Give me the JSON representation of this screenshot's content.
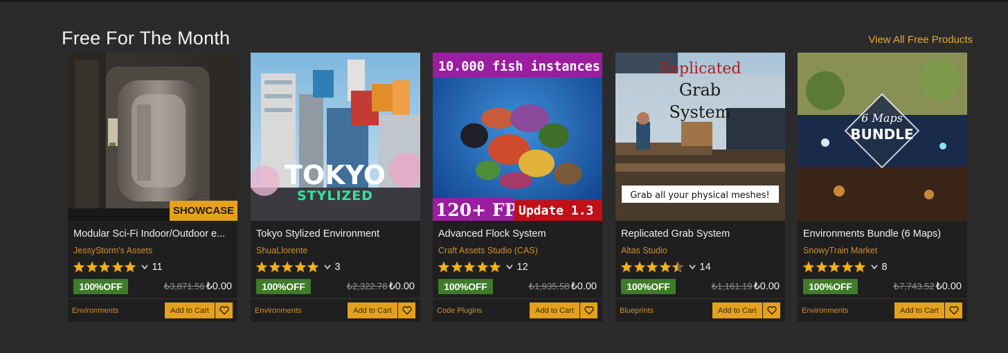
{
  "section": {
    "title": "Free For The Month",
    "view_all": "View All Free Products"
  },
  "colors": {
    "background": "#2b2b2b",
    "card": "#1f1f1f",
    "accent": "#e4a11b",
    "seller": "#cf8f2e",
    "discount_badge": "#3f7b2a"
  },
  "cards": [
    {
      "title": "Modular Sci-Fi Indoor/Outdoor e...",
      "seller": "JessyStorm's Assets",
      "rating": 5,
      "rating_count": "11",
      "discount": "100%OFF",
      "old_price": "₺3,871.56",
      "new_price": "₺0.00",
      "category": "Environments",
      "cart_label": "Add to Cart",
      "thumb_badge": "SHOWCASE"
    },
    {
      "title": "Tokyo Stylized Environment",
      "seller": "ShuaLlorente",
      "rating": 5,
      "rating_count": "3",
      "discount": "100%OFF",
      "old_price": "₺2,322.78",
      "new_price": "₺0.00",
      "category": "Environments",
      "cart_label": "Add to Cart",
      "thumb_text": {
        "line1": "TOKYO",
        "line2": "STYLIZED"
      }
    },
    {
      "title": "Advanced Flock System",
      "seller": "Craft Assets Studio (CAS)",
      "rating": 5,
      "rating_count": "12",
      "discount": "100%OFF",
      "old_price": "₺1,935.58",
      "new_price": "₺0.00",
      "category": "Code Plugins",
      "cart_label": "Add to Cart",
      "thumb_text": {
        "top": "10.000 fish instances",
        "bottom_left": "120+ FPS",
        "bottom_right": "Update 1.3"
      }
    },
    {
      "title": "Replicated Grab System",
      "seller": "Altas Studio",
      "rating": 4.5,
      "rating_count": "14",
      "discount": "100%OFF",
      "old_price": "₺1,161.19",
      "new_price": "₺0.00",
      "category": "Blueprints",
      "cart_label": "Add to Cart",
      "thumb_text": {
        "line1": "Replicated",
        "line2": "Grab",
        "line3": "System",
        "caption": "Grab all your physical meshes!"
      }
    },
    {
      "title": "Environments Bundle (6 Maps)",
      "seller": "SnowyTrain Market",
      "rating": 5,
      "rating_count": "8",
      "discount": "100%OFF",
      "old_price": "₺7,743.52",
      "new_price": "₺0.00",
      "category": "Environments",
      "cart_label": "Add to Cart",
      "thumb_text": {
        "line1": "6 Maps",
        "line2": "BUNDLE"
      }
    }
  ]
}
